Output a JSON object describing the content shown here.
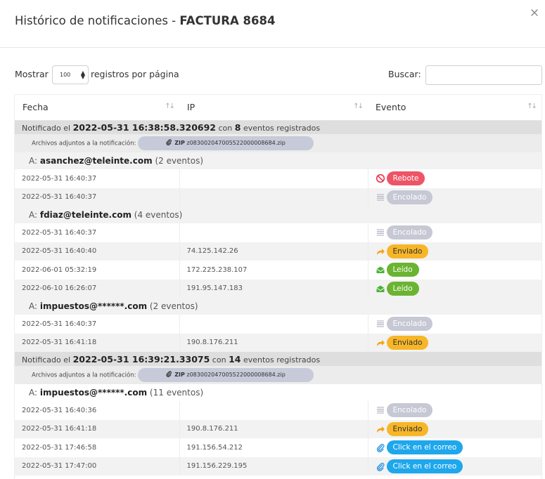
{
  "header": {
    "title_prefix": "Histórico de notificaciones - ",
    "title_doc": "FACTURA 8684"
  },
  "controls": {
    "show_label": "Mostrar",
    "length_value": "100",
    "records_label": "registros por página",
    "search_label": "Buscar:",
    "search_value": ""
  },
  "table": {
    "columns": [
      "Fecha",
      "IP",
      "Evento"
    ],
    "groups": [
      {
        "notified_prefix": "Notificado el ",
        "notified_datetime": "2022-05-31 16:38:58.320692",
        "count_prefix": " con ",
        "count": "8",
        "count_suffix": " eventos registrados",
        "attachments_label": "Archivos adjuntos a la notificación:",
        "zip_tag": "ZIP",
        "zip_file": "z083002047005522000008684.zip",
        "recipients": [
          {
            "prefix": "A: ",
            "email": "asanchez@teleinte.com",
            "events_count": "(2 eventos)",
            "events": [
              {
                "date": "2022-05-31 16:40:37",
                "ip": "",
                "icon": "blocked-icon",
                "label": "Rebote",
                "color": "red"
              },
              {
                "date": "2022-05-31 16:40:37",
                "ip": "",
                "icon": "queue-lines-icon",
                "label": "Encolado",
                "color": "gray"
              }
            ]
          },
          {
            "prefix": "A: ",
            "email": "fdiaz@teleinte.com",
            "events_count": "(4 eventos)",
            "events": [
              {
                "date": "2022-05-31 16:40:37",
                "ip": "",
                "icon": "queue-lines-icon",
                "label": "Encolado",
                "color": "gray"
              },
              {
                "date": "2022-05-31 16:40:40",
                "ip": "74.125.142.26",
                "icon": "forward-arrow-icon",
                "label": "Enviado",
                "color": "yellow"
              },
              {
                "date": "2022-06-01 05:32:19",
                "ip": "172.225.238.107",
                "icon": "open-envelope-icon",
                "label": "Leído",
                "color": "green"
              },
              {
                "date": "2022-06-10 16:26:07",
                "ip": "191.95.147.183",
                "icon": "open-envelope-icon",
                "label": "Leído",
                "color": "green"
              }
            ]
          },
          {
            "prefix": "A: ",
            "email": "impuestos@******.com",
            "events_count": "(2 eventos)",
            "events": [
              {
                "date": "2022-05-31 16:40:37",
                "ip": "",
                "icon": "queue-lines-icon",
                "label": "Encolado",
                "color": "gray"
              },
              {
                "date": "2022-05-31 16:41:18",
                "ip": "190.8.176.211",
                "icon": "forward-arrow-icon",
                "label": "Enviado",
                "color": "yellow"
              }
            ]
          }
        ]
      },
      {
        "notified_prefix": "Notificado el ",
        "notified_datetime": "2022-05-31 16:39:21.33075",
        "count_prefix": " con ",
        "count": "14",
        "count_suffix": " eventos registrados",
        "attachments_label": "Archivos adjuntos a la notificación:",
        "zip_tag": "ZIP",
        "zip_file": "z083002047005522000008684.zip",
        "recipients": [
          {
            "prefix": "A: ",
            "email": "impuestos@******.com",
            "events_count": "(11 eventos)",
            "events": [
              {
                "date": "2022-05-31 16:40:36",
                "ip": "",
                "icon": "queue-lines-icon",
                "label": "Encolado",
                "color": "gray"
              },
              {
                "date": "2022-05-31 16:41:18",
                "ip": "190.8.176.211",
                "icon": "forward-arrow-icon",
                "label": "Enviado",
                "color": "yellow"
              },
              {
                "date": "2022-05-31 17:46:58",
                "ip": "191.156.54.212",
                "icon": "paperclip-icon",
                "label": "Click en el correo",
                "color": "blue"
              },
              {
                "date": "2022-05-31 17:47:00",
                "ip": "191.156.229.195",
                "icon": "paperclip-icon",
                "label": "Click en el correo",
                "color": "blue"
              }
            ]
          }
        ]
      }
    ]
  },
  "colors": {
    "red": "#ee5466",
    "gray": "#c6c8d4",
    "yellow": "#f6b627",
    "green": "#6ab431",
    "blue": "#1ea7ec"
  }
}
